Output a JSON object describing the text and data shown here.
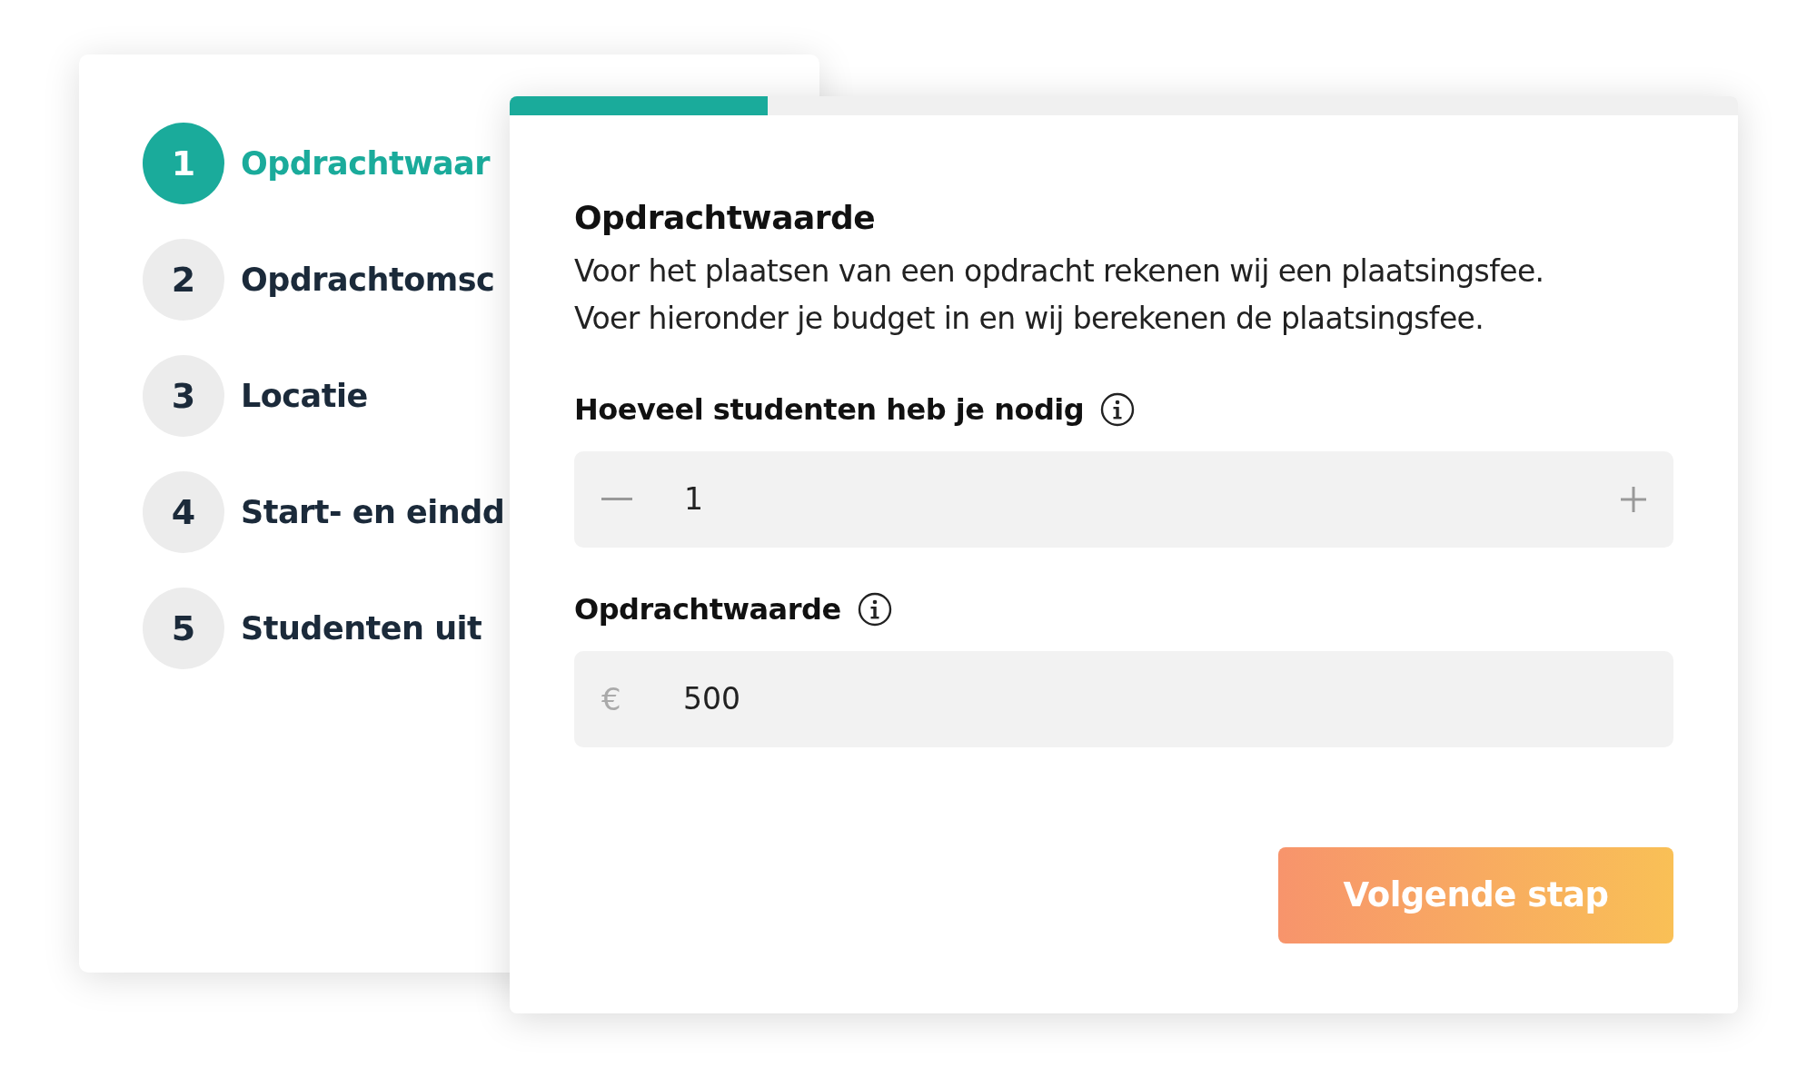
{
  "steps": [
    {
      "number": "1",
      "label": "Opdrachtwaar",
      "selected": true
    },
    {
      "number": "2",
      "label": "Opdrachtomsc",
      "selected": false
    },
    {
      "number": "3",
      "label": "Locatie",
      "selected": false
    },
    {
      "number": "4",
      "label": "Start- en eindd",
      "selected": false
    },
    {
      "number": "5",
      "label": "Studenten uit",
      "selected": false
    }
  ],
  "progress": {
    "level": 0.21
  },
  "form": {
    "title": "Opdrachtwaarde",
    "description": [
      "Voor het plaatsen van een opdracht rekenen wij een plaatsingsfee.",
      "Voer hieronder je budget in en wij berekenen de plaatsingsfee."
    ],
    "fields": [
      {
        "kind": "stepper",
        "label": "Hoeveel studenten heb je nodig",
        "value": "1"
      },
      {
        "kind": "currency",
        "label": "Opdrachtwaarde",
        "prefix": "€",
        "value": "500"
      }
    ],
    "submit": "Volgende stap"
  }
}
